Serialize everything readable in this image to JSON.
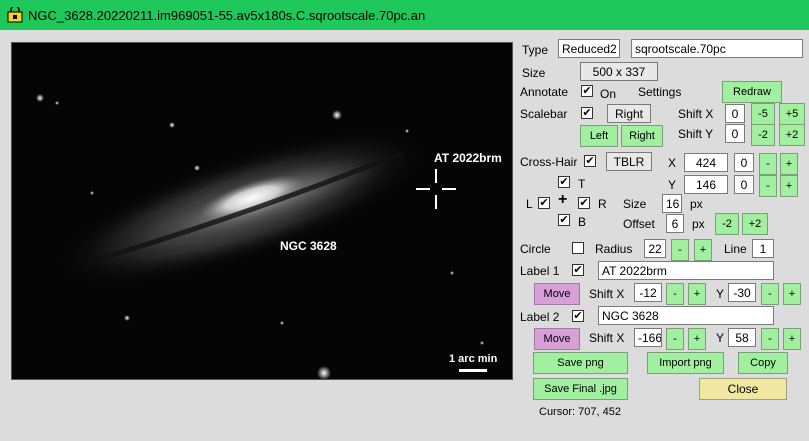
{
  "window": {
    "title": "NGC_3628.20220211.im969051-55.av5x180s.C.sqrootscale.70pc.an"
  },
  "image": {
    "label_at": "AT 2022brm",
    "label_ngc": "NGC 3628",
    "scalebar_text": "1 arc min"
  },
  "type": {
    "label": "Type",
    "value": "Reduced2",
    "scale_value": "sqrootscale.70pc"
  },
  "size": {
    "label": "Size",
    "value": "500 x 337"
  },
  "annotate": {
    "label": "Annotate",
    "on_label": "On",
    "checked": true,
    "settings_label": "Settings",
    "redraw_label": "Redraw"
  },
  "scalebar": {
    "label": "Scalebar",
    "checked": true,
    "position_value": "Right",
    "shift_x_label": "Shift X",
    "shift_x_value": "0",
    "minus5": "-5",
    "plus5": "+5",
    "shift_y_label": "Shift Y",
    "shift_y_value": "0",
    "minus2": "-2",
    "plus2": "+2",
    "left_label": "Left",
    "right_label": "Right"
  },
  "crosshair": {
    "label": "Cross-Hair",
    "checked": true,
    "mode_value": "TBLR",
    "x_label": "X",
    "x_value": "424",
    "x_step": "0",
    "y_label": "Y",
    "y_value": "146",
    "y_step": "0",
    "minus": "-",
    "plus": "+",
    "t_label": "T",
    "l_label": "L",
    "r_label": "R",
    "b_label": "B",
    "center_glyph": "+",
    "size_label": "Size",
    "size_value": "16",
    "size_unit": "px",
    "offset_label": "Offset",
    "offset_value": "6",
    "offset_unit": "px",
    "offset_minus": "-2",
    "offset_plus": "+2"
  },
  "circle": {
    "label": "Circle",
    "checked": false,
    "radius_label": "Radius",
    "radius_value": "22",
    "minus": "-",
    "plus": "+",
    "line_label": "Line",
    "line_value": "1"
  },
  "label1": {
    "label": "Label 1",
    "checked": true,
    "text_value": "AT 2022brm",
    "move_label": "Move",
    "shift_x_label": "Shift X",
    "shift_x_value": "-12",
    "y_label": "Y",
    "y_value": "-30",
    "minus": "-",
    "plus": "+"
  },
  "label2": {
    "label": "Label 2",
    "checked": true,
    "text_value": "NGC 3628",
    "move_label": "Move",
    "shift_x_label": "Shift X",
    "shift_x_value": "-166",
    "y_label": "Y",
    "y_value": "58",
    "minus": "-",
    "plus": "+"
  },
  "actions": {
    "save_png": "Save png",
    "import_png": "Import png",
    "copy": "Copy",
    "save_final": "Save Final .jpg",
    "close": "Close"
  },
  "status": {
    "cursor_text": "Cursor: 707, 452"
  },
  "colors": {
    "titlebar": "#1ec85a",
    "button_green": "#a0f0a0",
    "button_purple": "#d8a0d8",
    "button_yellow": "#f0e8a0"
  }
}
